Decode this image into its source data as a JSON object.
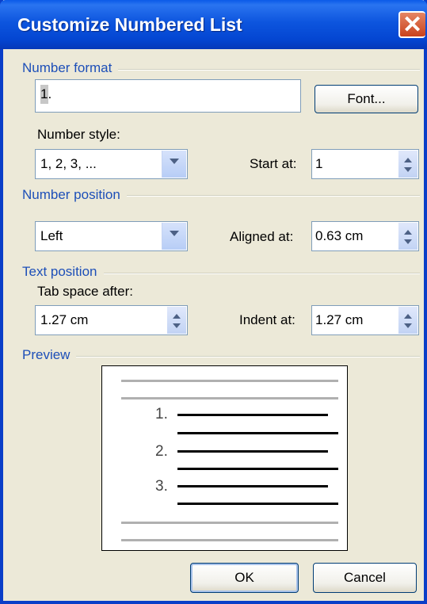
{
  "window": {
    "title": "Customize Numbered List",
    "close_glyph": "✕"
  },
  "number_format": {
    "group_label": "Number format",
    "value": "1.",
    "font_button": "Font...",
    "style_label": "Number style:",
    "style_value": "1, 2, 3, ...",
    "start_label": "Start at:",
    "start_value": "1"
  },
  "number_position": {
    "group_label": "Number position",
    "align_value": "Left",
    "aligned_label": "Aligned at:",
    "aligned_value": "0.63 cm"
  },
  "text_position": {
    "group_label": "Text position",
    "tab_label": "Tab space after:",
    "tab_value": "1.27 cm",
    "indent_label": "Indent at:",
    "indent_value": "1.27 cm"
  },
  "preview": {
    "group_label": "Preview",
    "numbers": [
      "1.",
      "2.",
      "3."
    ]
  },
  "buttons": {
    "ok": "OK",
    "cancel": "Cancel"
  },
  "icons": [
    "close-icon",
    "dropdown-arrow-icon",
    "spin-up-icon",
    "spin-down-icon"
  ]
}
